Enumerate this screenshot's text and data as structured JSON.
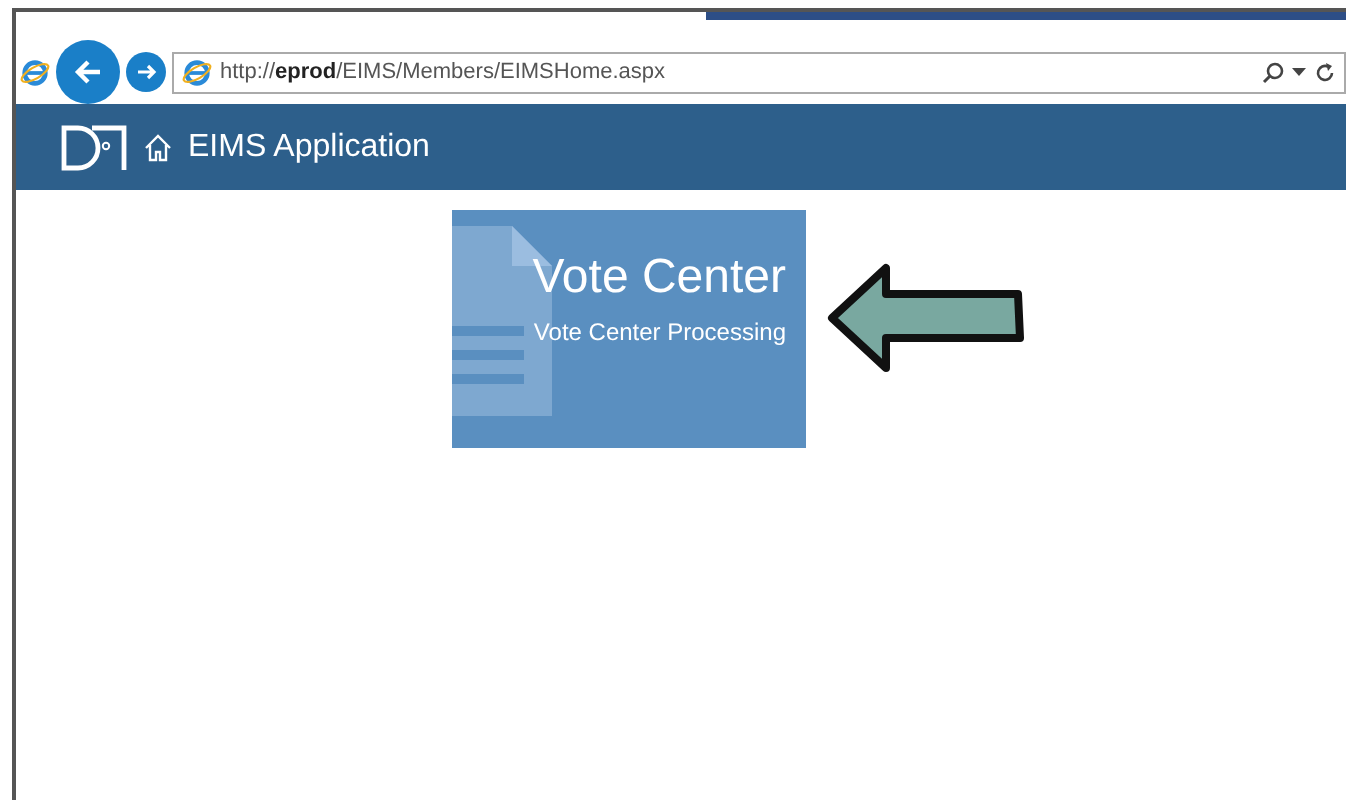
{
  "browser": {
    "url": "http://**eprod**/EIMS/Members/EIMSHome.aspx"
  },
  "header": {
    "title": "EIMS Application"
  },
  "tile": {
    "title": "Vote Center",
    "subtitle": "Vote Center Processing"
  }
}
